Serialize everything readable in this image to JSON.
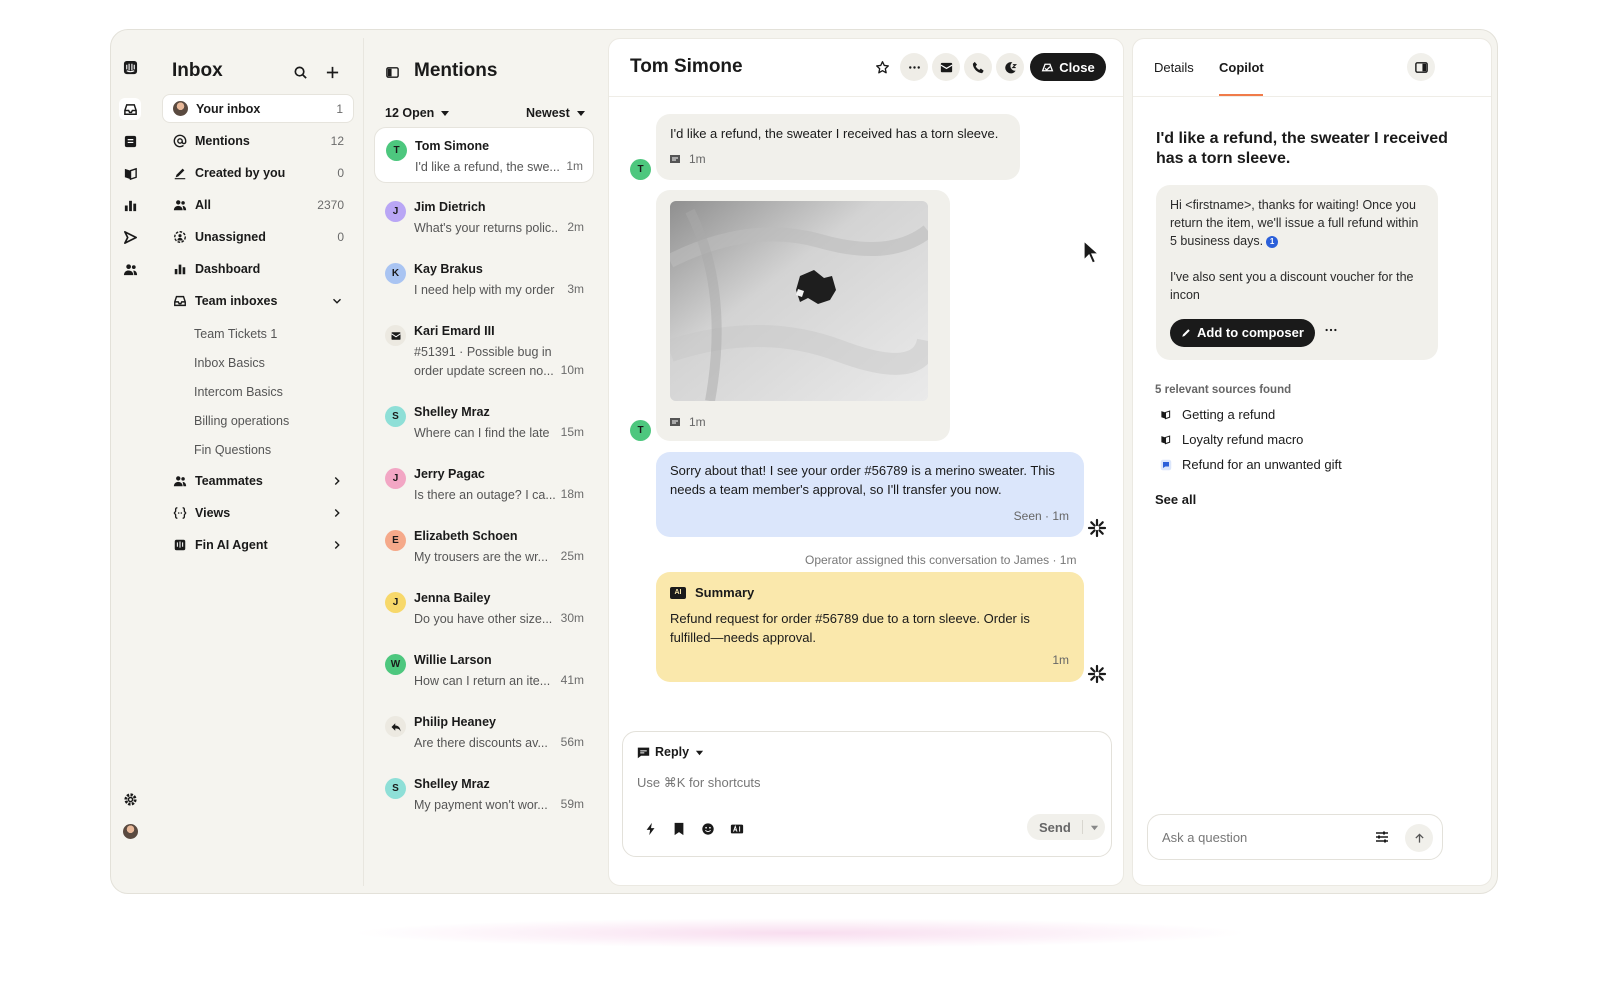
{
  "nav": {
    "title": "Inbox",
    "items": [
      {
        "label": "Your inbox",
        "count": "1"
      },
      {
        "label": "Mentions",
        "count": "12"
      },
      {
        "label": "Created by you",
        "count": "0"
      },
      {
        "label": "All",
        "count": "2370"
      },
      {
        "label": "Unassigned",
        "count": "0"
      },
      {
        "label": "Dashboard"
      },
      {
        "label": "Team inboxes"
      }
    ],
    "team_inboxes": [
      "Team Tickets 1",
      "Inbox Basics",
      "Intercom Basics",
      "Billing operations",
      "Fin Questions"
    ],
    "sections": [
      "Teammates",
      "Views",
      "Fin AI Agent"
    ]
  },
  "list": {
    "title": "Mentions",
    "filter_status": "12 Open",
    "filter_sort": "Newest",
    "conversations": [
      {
        "initial": "T",
        "name": "Tom Simone",
        "preview": "I'd like a refund, the swe...",
        "time": "1m",
        "color": "#4dc77e"
      },
      {
        "initial": "J",
        "name": "Jim Dietrich",
        "preview": "What's your returns polic...",
        "time": "2m",
        "color": "#b9a6f5"
      },
      {
        "initial": "K",
        "name": "Kay Brakus",
        "preview": "I need help with my order",
        "time": "3m",
        "color": "#a9c4f2"
      },
      {
        "initial": "",
        "name": "Kari Emard III",
        "preview": "#51391 · Possible bug in",
        "preview2": "order update screen no...",
        "time": "10m",
        "color": "#ece9e1"
      },
      {
        "initial": "S",
        "name": "Shelley Mraz",
        "preview": "Where can I find the late",
        "time": "15m",
        "color": "#8edfd7"
      },
      {
        "initial": "J",
        "name": "Jerry Pagac",
        "preview": "Is there an outage? I ca...",
        "time": "18m",
        "color": "#f2a6c4"
      },
      {
        "initial": "E",
        "name": "Elizabeth Schoen",
        "preview": "My trousers are the wr...",
        "time": "25m",
        "color": "#f5a98a"
      },
      {
        "initial": "J",
        "name": "Jenna Bailey",
        "preview": "Do you have other size...",
        "time": "30m",
        "color": "#f7d86a"
      },
      {
        "initial": "W",
        "name": "Willie Larson",
        "preview": "How can I return an ite...",
        "time": "41m",
        "color": "#4dc77e"
      },
      {
        "initial": "",
        "name": "Philip Heaney",
        "preview": "Are there discounts av...",
        "time": "56m",
        "color": "#ece9e1"
      },
      {
        "initial": "S",
        "name": "Shelley Mraz",
        "preview": "My payment won't wor...",
        "time": "59m",
        "color": "#8edfd7"
      }
    ]
  },
  "chat": {
    "title": "Tom Simone",
    "close_label": "Close",
    "messages": {
      "m1": {
        "text": "I'd like a refund, the sweater I received has a torn sleeve.",
        "time": "1m",
        "avatar": "T"
      },
      "m2": {
        "time": "1m",
        "avatar": "T"
      },
      "m3": {
        "text": "Sorry about that! I see your order #56789 is a merino sweater. This needs a team member's approval, so I'll transfer you now.",
        "status": "Seen · 1m"
      },
      "system": "Operator assigned this conversation to James · 1m",
      "summary": {
        "label": "Summary",
        "badge": "AI",
        "text": "Refund request for order #56789 due to a torn sleeve. Order is fulfilled—needs approval.",
        "time": "1m"
      }
    },
    "composer": {
      "mode": "Reply",
      "placeholder": "Use ⌘K for shortcuts",
      "send": "Send"
    }
  },
  "copilot": {
    "tabs": [
      "Details",
      "Copilot"
    ],
    "question": "I'd like a refund, the sweater I received has a torn sleeve.",
    "answer_p1": "Hi <firstname>, thanks for waiting! Once you return the item, we'll issue a full refund within 5 business days.",
    "citation": "1",
    "answer_p2": "I've also sent you a discount voucher for the incon",
    "add_label": "Add to composer",
    "sources_title": "5 relevant sources found",
    "sources": [
      "Getting a refund",
      "Loyalty refund macro",
      "Refund for an unwanted gift"
    ],
    "see_all": "See all",
    "ask_placeholder": "Ask a question"
  },
  "colors": {
    "accent": "#f07b4a",
    "agent_bubble": "#dbe6fb",
    "summary_bubble": "#fae8ac",
    "primary_button": "#1a1a1a"
  }
}
